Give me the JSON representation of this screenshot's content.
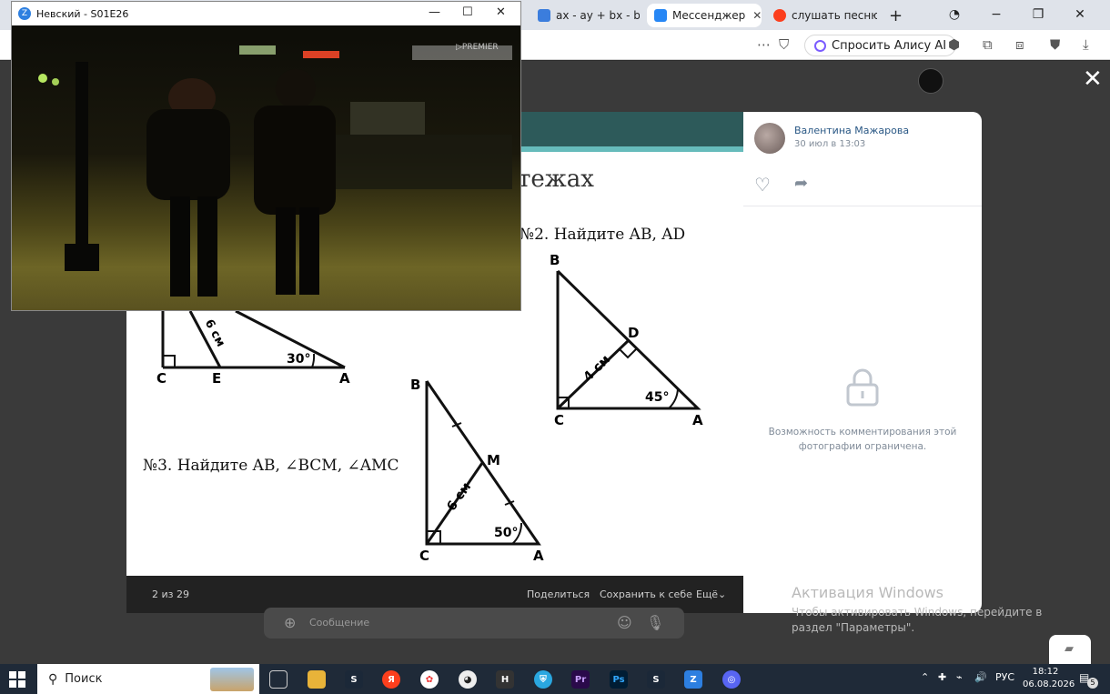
{
  "browser": {
    "tabs": [
      {
        "label": "ах - ay + bx - by -",
        "color": "#3b7ddd"
      },
      {
        "label": "Мессенджер",
        "color": "#2787f5"
      },
      {
        "label": "слушать песню до",
        "color": "#fc3f1d"
      }
    ],
    "alice_label": "Спросить Алису AI"
  },
  "video": {
    "title": "Невский - S01E26",
    "watermark": "▷PREMIER"
  },
  "photo": {
    "heading_fragment": "тежах",
    "problem2": "№2.  Найдите AB,  AD",
    "problem3": "№3.  Найдите AB,  ∠BCM,  ∠AMC",
    "fig1": {
      "label_c": "C",
      "label_e": "E",
      "label_a": "A",
      "side": "6 см",
      "angle": "30°"
    },
    "fig2": {
      "label_b": "B",
      "label_d": "D",
      "label_c": "C",
      "label_a": "A",
      "side": "4 см",
      "angle": "45°"
    },
    "fig3": {
      "label_b": "B",
      "label_m": "M",
      "label_c": "C",
      "label_a": "A",
      "side": "6 см",
      "angle": "50°"
    }
  },
  "viewer": {
    "counter": "2 из 29",
    "share": "Поделиться",
    "save": "Сохранить к себе",
    "more": "Ещё",
    "author": "Валентина Мажарова",
    "date": "30 июл в 13:03",
    "restricted": "Возможность комментирования этой фотографии ограничена.",
    "message_placeholder": "Сообщение"
  },
  "windows_activation": {
    "title": "Активация Windows",
    "text": "Чтобы активировать Windows, перейдите в раздел \"Параметры\"."
  },
  "taskbar": {
    "search": "Поиск",
    "lang": "РУС",
    "time": "18:12",
    "date": "06.08.2026",
    "notifications": "5"
  }
}
